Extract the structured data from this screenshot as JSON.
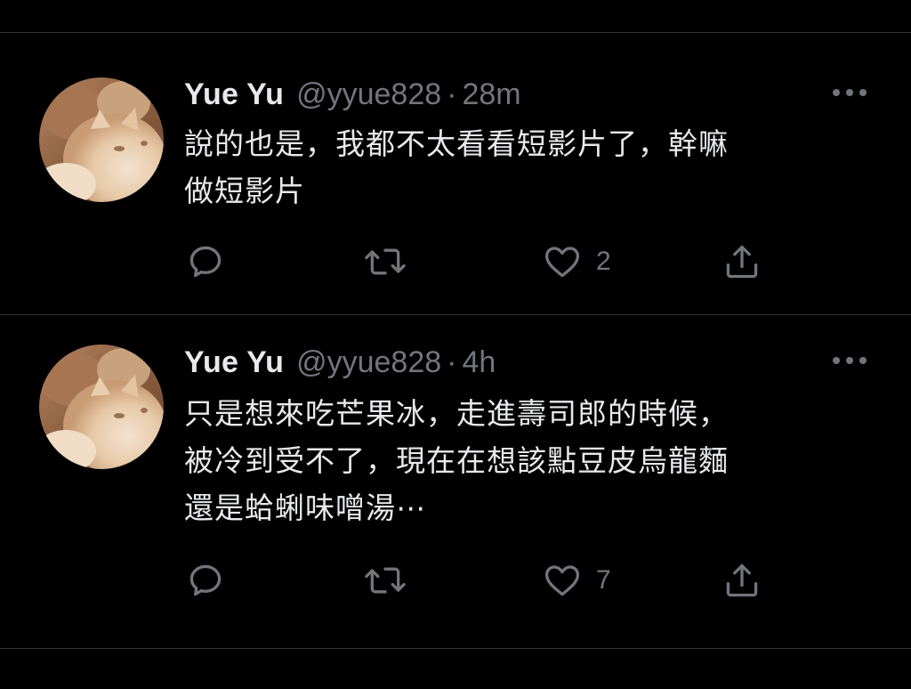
{
  "tweets": [
    {
      "display_name": "Yue Yu",
      "handle": "@yyue828",
      "separator": "·",
      "timestamp": "28m",
      "text_lines": [
        "說的也是，我都不太看看短影片了，幹嘛",
        "做短影片"
      ],
      "likes": "2"
    },
    {
      "display_name": "Yue Yu",
      "handle": "@yyue828",
      "separator": "·",
      "timestamp": "4h",
      "text_lines": [
        "只是想來吃芒果冰，走進壽司郎的時候，",
        "被冷到受不了，現在在想該點豆皮烏龍麵",
        "還是蛤蜊味噌湯⋯"
      ],
      "likes": "7"
    }
  ],
  "icons": {
    "avatar": "cat-photo-avatar",
    "more": "more-horizontal-icon",
    "reply": "reply-icon",
    "retweet": "retweet-icon",
    "like": "heart-icon",
    "share": "share-icon"
  },
  "colors": {
    "background": "#000000",
    "text": "#e7e9ea",
    "secondary": "#71767b",
    "divider": "#2f3336"
  }
}
